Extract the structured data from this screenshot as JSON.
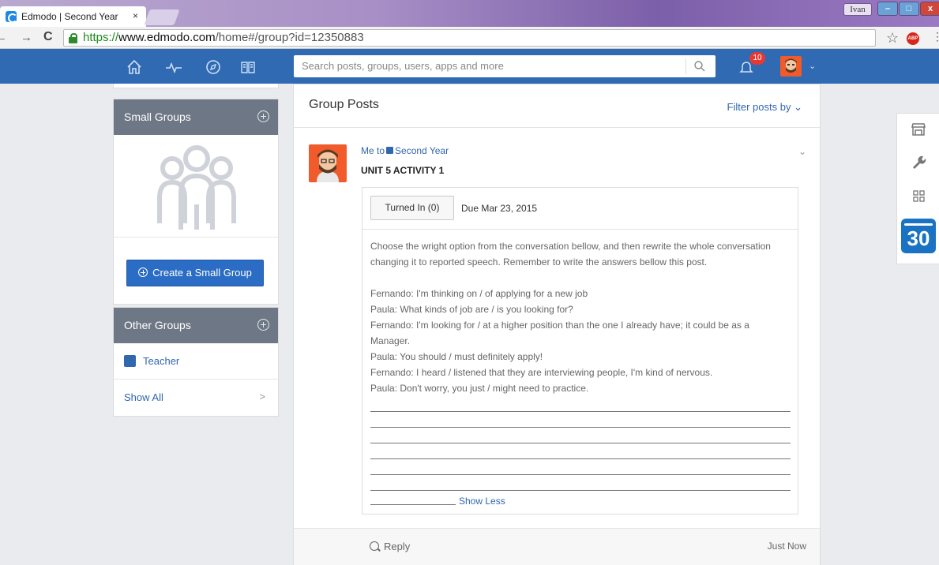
{
  "browser": {
    "tab_title": "Edmodo | Second Year",
    "tab_close": "×",
    "url_scheme": "https://",
    "url_host": "www.edmodo.com",
    "url_path": "/home#/group?id=12350883",
    "window_user": "Ivan",
    "back_arrow": "←",
    "forward_arrow": "→",
    "reload_glyph": "C",
    "star_glyph": "☆",
    "abp_label": "ABP",
    "menu_glyph": "⋮",
    "win_min": "–",
    "win_max": "□",
    "win_close": "x"
  },
  "nav": {
    "icons": [
      "home-icon",
      "activity-icon",
      "discover-icon",
      "library-icon"
    ],
    "search_placeholder": "Search posts, groups, users, apps and more",
    "notification_count": "10",
    "caret": "⌄"
  },
  "sidebar": {
    "small_groups": {
      "title": "Small Groups",
      "create_label": "Create a Small Group"
    },
    "other_groups": {
      "title": "Other Groups",
      "items": [
        {
          "label": "Teacher",
          "color": "#3167ad"
        }
      ],
      "show_all": "Show All",
      "show_all_chev": ">"
    }
  },
  "feed": {
    "title": "Group Posts",
    "filter_label": "Filter posts by",
    "filter_caret": "⌄",
    "post": {
      "sender": "Me",
      "to_word": "to",
      "group": "Second Year",
      "title": "UNIT 5 ACTIVITY 1",
      "caret": "⌄",
      "turned_in": "Turned In (0)",
      "due": "Due Mar 23, 2015",
      "instructions": "Choose the wright option from the conversation bellow, and then rewrite the whole conversation changing it to reported speech. Remember to write the answers bellow this post.",
      "lines": [
        "Fernando: I'm thinking on / of applying for a new job",
        "Paula: What kinds of job are / is you looking for?",
        "Fernando: I'm looking for / at a higher position than the one I already have; it could be as a Manager.",
        "Paula: You should / must definitely apply!",
        "Fernando: I heard / listened that they are interviewing people, I'm kind of nervous.",
        "Paula: Don't worry, you just / might need to practice."
      ],
      "show_less": "Show Less",
      "reply": "Reply",
      "timestamp": "Just Now"
    }
  },
  "rail": {
    "icons": [
      "store-icon",
      "wrench-icon",
      "apps-grid-icon",
      "calendar-icon"
    ],
    "calendar_day": "30"
  },
  "colors": {
    "brand_blue": "#2f6ab3",
    "link_blue": "#3167ad",
    "panel_head": "#6e7785",
    "avatar_orange": "#f15a2b",
    "badge_red": "#e53935"
  }
}
